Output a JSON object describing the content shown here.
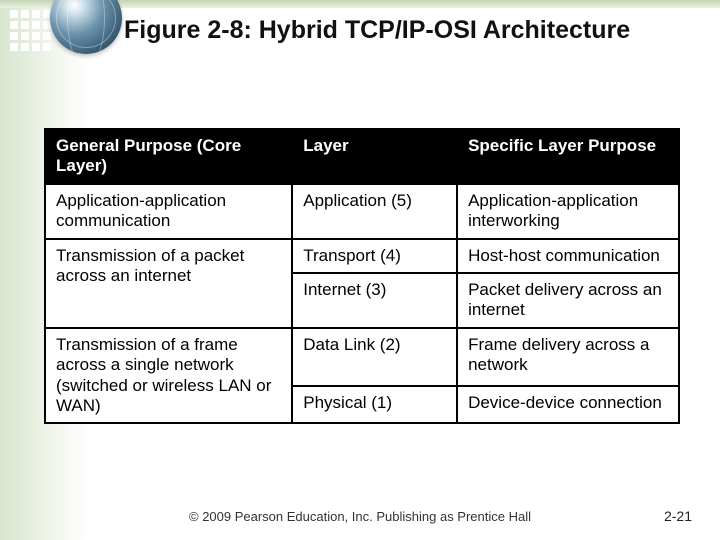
{
  "title": "Figure 2-8: Hybrid TCP/IP-OSI Architecture",
  "headers": {
    "c0": "General Purpose (Core Layer)",
    "c1": "Layer",
    "c2": "Specific Layer Purpose"
  },
  "rows": {
    "r0": {
      "gp": "Application-application communication",
      "layer": "Application (5)",
      "spec": "Application-application interworking"
    },
    "r1": {
      "gp": "Transmission of a packet across an internet",
      "layer_a": "Transport (4)",
      "spec_a": "Host-host communication",
      "layer_b": "Internet (3)",
      "spec_b": "Packet delivery across an internet"
    },
    "r2": {
      "gp": "Transmission of a frame across a single network (switched or wireless LAN or WAN)",
      "layer_a": "Data Link (2)",
      "spec_a": "Frame delivery across a network",
      "layer_b": "Physical (1)",
      "spec_b": "Device-device connection"
    }
  },
  "footer": "© 2009 Pearson Education, Inc.  Publishing as Prentice Hall",
  "page_number": "2-21"
}
